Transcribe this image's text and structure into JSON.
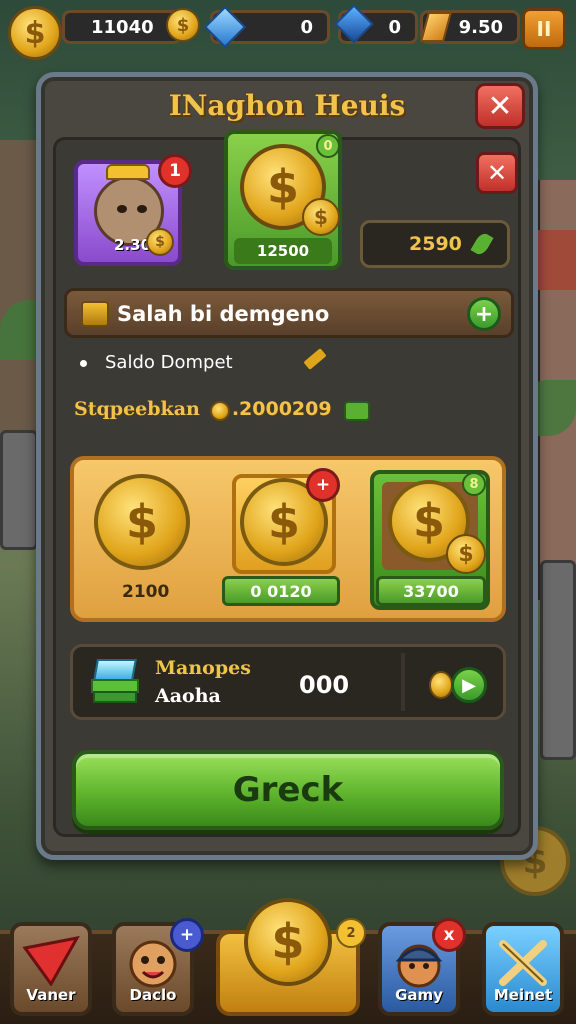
{
  "topbar": {
    "coins": "11040",
    "gems_blue": "0",
    "gems_dark": "0",
    "gold_bars": "9.50"
  },
  "dialog": {
    "title": "INaghon Heuis",
    "avatar_value": "2.300",
    "avatar_badge": "1",
    "featured_coin_value": "12500",
    "featured_badge": "0",
    "value_box": "2590",
    "bar_text": "Salah bi demgeno",
    "bullet_text": "Saldo Dompet",
    "stat_label": "Stqpeebkan",
    "stat_value": ".2000209"
  },
  "shop": {
    "items": [
      {
        "label": "2100"
      },
      {
        "label": "0 0120",
        "badge": "+"
      },
      {
        "label": "33700",
        "badge": "8"
      }
    ]
  },
  "gem_row": {
    "title": "Manopes",
    "subtitle": "Aaoha",
    "value": "000"
  },
  "main_button": "Greck",
  "nav": {
    "items": [
      {
        "label": "Vaner"
      },
      {
        "label": "Daclo",
        "badge": "+"
      },
      {
        "label": "Gamy",
        "badge": "x"
      },
      {
        "label": "Meinet"
      }
    ],
    "center_badge": "2"
  },
  "colors": {
    "gold": "#f2c34a",
    "green": "#5ab02a",
    "red": "#e0322a",
    "panel": "#4a4740"
  }
}
